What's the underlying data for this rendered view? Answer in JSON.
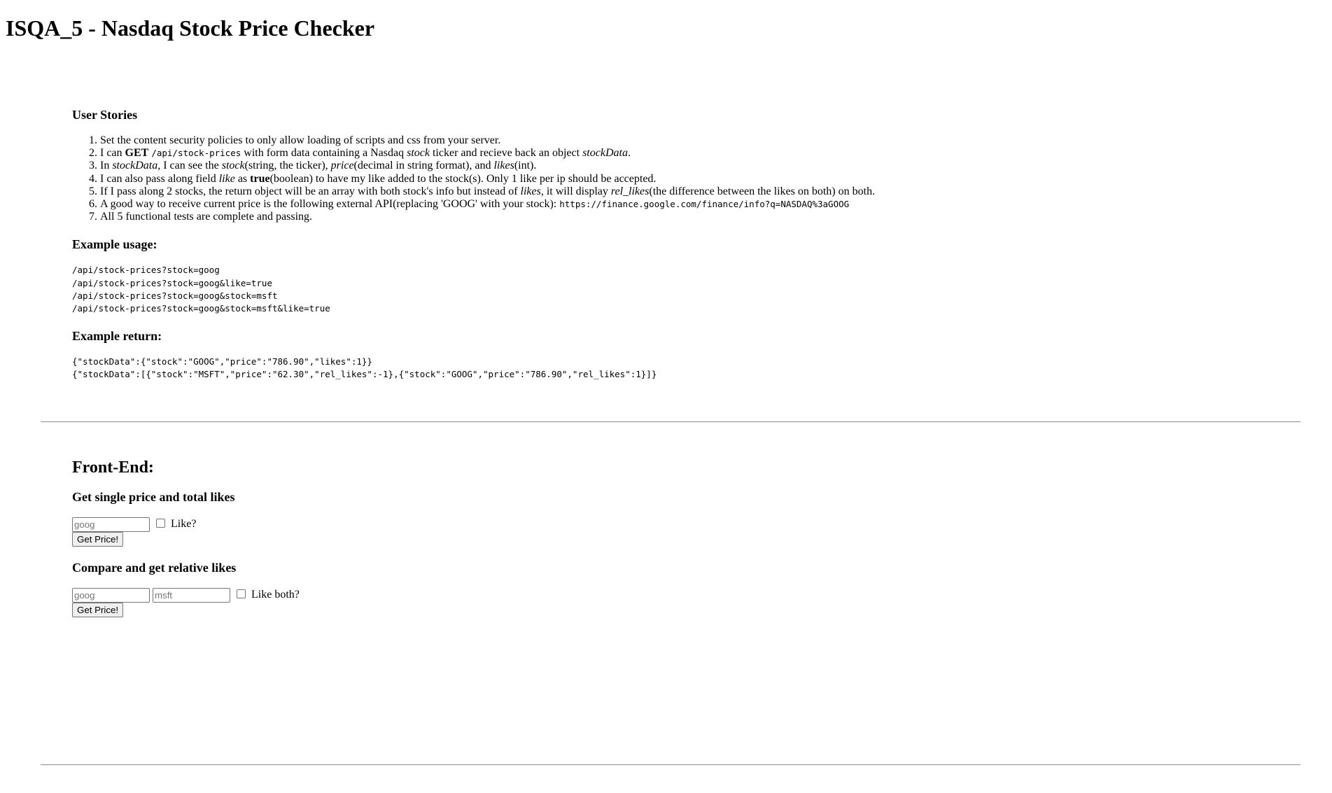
{
  "page": {
    "title": "ISQA_5 - Nasdaq Stock Price Checker"
  },
  "user_stories": {
    "heading": "User Stories",
    "items": {
      "s1": "Set the content security policies to only allow loading of scripts and css from your server.",
      "s2": {
        "a": "I can ",
        "b": "GET",
        "c": " ",
        "d": "/api/stock-prices",
        "e": " with form data containing a Nasdaq ",
        "f": "stock",
        "g": " ticker and recieve back an object ",
        "h": "stockData",
        "i": "."
      },
      "s3": {
        "a": "In ",
        "b": "stockData",
        "c": ", I can see the ",
        "d": "stock",
        "e": "(string, the ticker), ",
        "f": "price",
        "g": "(decimal in string format), and ",
        "h": "likes",
        "i": "(int)."
      },
      "s4": {
        "a": "I can also pass along field ",
        "b": "like",
        "c": " as ",
        "d": "true",
        "e": "(boolean) to have my like added to the stock(s). Only 1 like per ip should be accepted."
      },
      "s5": {
        "a": "If I pass along 2 stocks, the return object will be an array with both stock's info but instead of ",
        "b": "likes",
        "c": ", it will display ",
        "d": "rel_likes",
        "e": "(the difference between the likes on both) on both."
      },
      "s6": {
        "a": "A good way to receive current price is the following external API(replacing 'GOOG' with your stock): ",
        "b": "https://finance.google.com/finance/info?q=NASDAQ%3aGOOG"
      },
      "s7": "All 5 functional tests are complete and passing."
    }
  },
  "example_usage": {
    "heading": "Example usage:",
    "lines": {
      "l1": "/api/stock-prices?stock=goog",
      "l2": "/api/stock-prices?stock=goog&like=true",
      "l3": "/api/stock-prices?stock=goog&stock=msft",
      "l4": "/api/stock-prices?stock=goog&stock=msft&like=true"
    }
  },
  "example_return": {
    "heading": "Example return:",
    "lines": {
      "l1": "{\"stockData\":{\"stock\":\"GOOG\",\"price\":\"786.90\",\"likes\":1}}",
      "l2": "{\"stockData\":[{\"stock\":\"MSFT\",\"price\":\"62.30\",\"rel_likes\":-1},{\"stock\":\"GOOG\",\"price\":\"786.90\",\"rel_likes\":1}]}"
    }
  },
  "front_end": {
    "title": "Front-End:",
    "single_form": {
      "heading": "Get single price and total likes",
      "stock_placeholder": "goog",
      "like_label": "Like?",
      "submit_label": "Get Price!"
    },
    "compare_form": {
      "heading": "Compare and get relative likes",
      "stock1_placeholder": "goog",
      "stock2_placeholder": "msft",
      "like_label": "Like both?",
      "submit_label": "Get Price!"
    }
  }
}
